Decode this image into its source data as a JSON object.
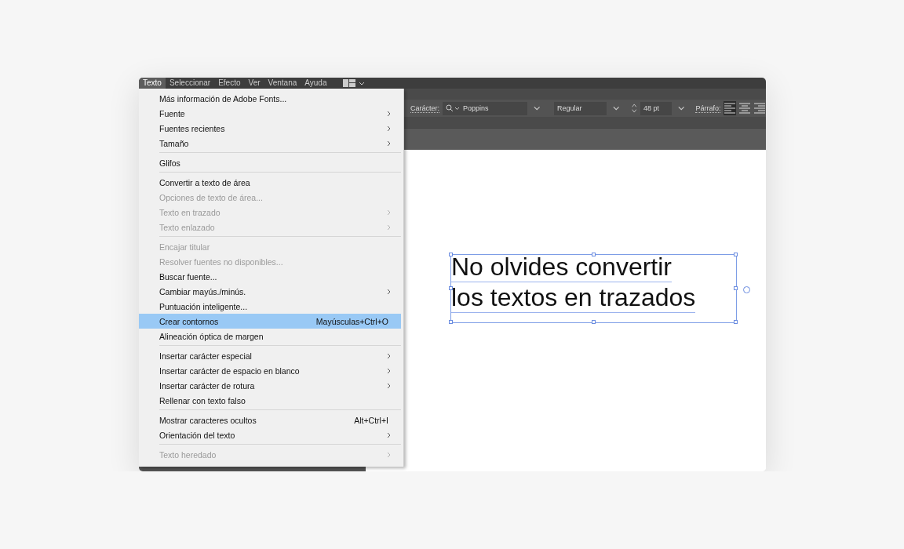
{
  "menubar": [
    {
      "label": "Texto",
      "selected": true
    },
    {
      "label": "Seleccionar",
      "selected": false
    },
    {
      "label": "Efecto",
      "selected": false
    },
    {
      "label": "Ver",
      "selected": false
    },
    {
      "label": "Ventana",
      "selected": false
    },
    {
      "label": "Ayuda",
      "selected": false
    }
  ],
  "control_bar": {
    "character_label": "Carácter:",
    "font": "Poppins",
    "style": "Regular",
    "size": "48 pt",
    "paragraph_label": "Párrafo:",
    "alignments": [
      {
        "kind": "left",
        "selected": true
      },
      {
        "kind": "center",
        "selected": false
      },
      {
        "kind": "right",
        "selected": false
      }
    ]
  },
  "menu": [
    [
      {
        "label": "Más información de Adobe Fonts...",
        "disabled": false,
        "submenu": false,
        "selected": false
      },
      {
        "label": "Fuente",
        "disabled": false,
        "submenu": true,
        "selected": false
      },
      {
        "label": "Fuentes recientes",
        "disabled": false,
        "submenu": true,
        "selected": false
      },
      {
        "label": "Tamaño",
        "disabled": false,
        "submenu": true,
        "selected": false
      }
    ],
    [
      {
        "label": "Glifos",
        "disabled": false,
        "submenu": false,
        "selected": false
      }
    ],
    [
      {
        "label": "Convertir a texto de área",
        "disabled": false,
        "submenu": false,
        "selected": false
      },
      {
        "label": "Opciones de texto de área...",
        "disabled": true,
        "submenu": false,
        "selected": false
      },
      {
        "label": "Texto en trazado",
        "disabled": true,
        "submenu": true,
        "selected": false
      },
      {
        "label": "Texto enlazado",
        "disabled": true,
        "submenu": true,
        "selected": false
      }
    ],
    [
      {
        "label": "Encajar titular",
        "disabled": true,
        "submenu": false,
        "selected": false
      },
      {
        "label": "Resolver fuentes no disponibles...",
        "disabled": true,
        "submenu": false,
        "selected": false
      },
      {
        "label": "Buscar fuente...",
        "disabled": false,
        "submenu": false,
        "selected": false
      },
      {
        "label": "Cambiar mayús./minús.",
        "disabled": false,
        "submenu": true,
        "selected": false
      },
      {
        "label": "Puntuación inteligente...",
        "disabled": false,
        "submenu": false,
        "selected": false
      },
      {
        "label": "Crear contornos",
        "shortcut": "Mayúsculas+Ctrl+O",
        "disabled": false,
        "submenu": false,
        "selected": true
      },
      {
        "label": "Alineación óptica de margen",
        "disabled": false,
        "submenu": false,
        "selected": false
      }
    ],
    [
      {
        "label": "Insertar carácter especial",
        "disabled": false,
        "submenu": true,
        "selected": false
      },
      {
        "label": "Insertar carácter de espacio en blanco",
        "disabled": false,
        "submenu": true,
        "selected": false
      },
      {
        "label": "Insertar carácter de rotura",
        "disabled": false,
        "submenu": true,
        "selected": false
      },
      {
        "label": "Rellenar con texto falso",
        "disabled": false,
        "submenu": false,
        "selected": false
      }
    ],
    [
      {
        "label": "Mostrar caracteres ocultos",
        "shortcut": "Alt+Ctrl+I",
        "disabled": false,
        "submenu": false,
        "selected": false
      },
      {
        "label": "Orientación del texto",
        "disabled": false,
        "submenu": true,
        "selected": false
      }
    ],
    [
      {
        "label": "Texto heredado",
        "disabled": true,
        "submenu": true,
        "selected": false
      }
    ]
  ],
  "canvas": {
    "text_lines": [
      "No olvides convertir",
      "los textos en trazados"
    ]
  }
}
